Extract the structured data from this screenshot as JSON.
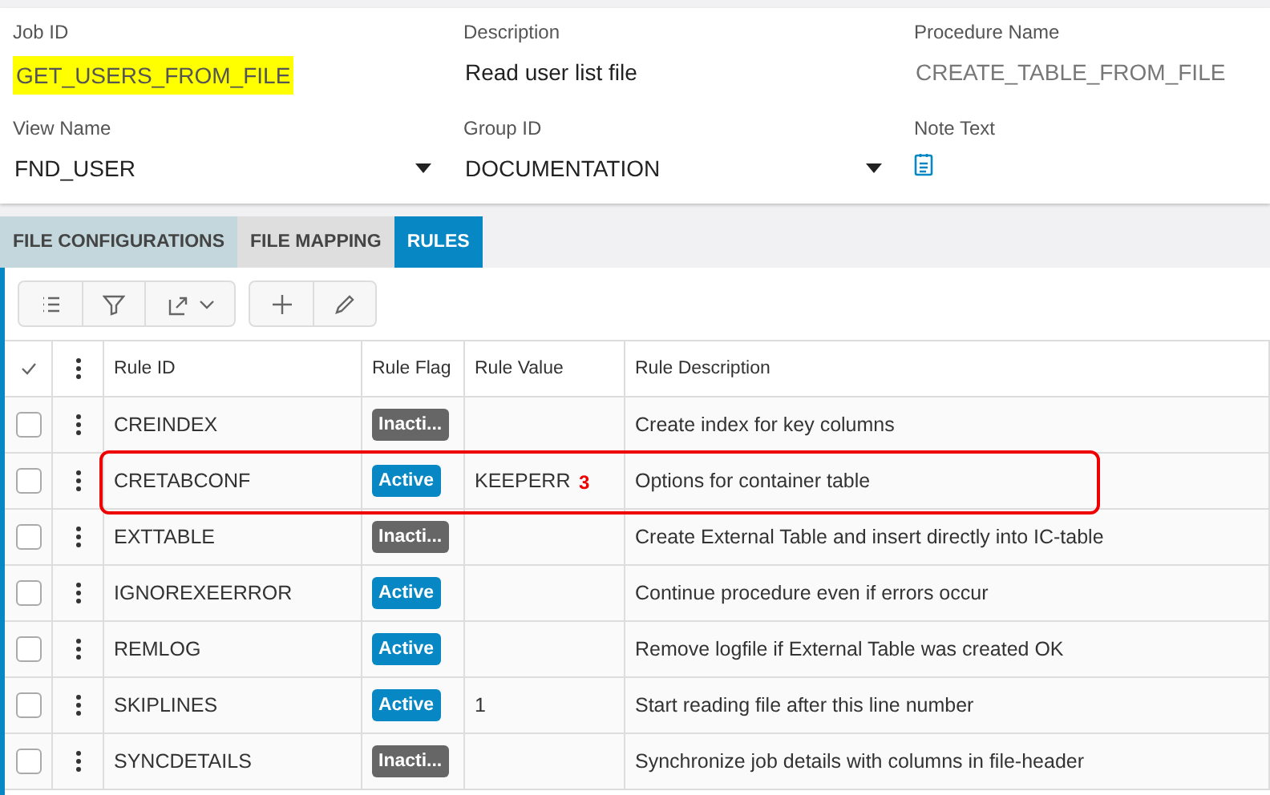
{
  "form": {
    "fields": [
      {
        "kind": "text",
        "label": "Job ID",
        "value": "GET_USERS_FROM_FILE",
        "highlighted": true,
        "disabled": false
      },
      {
        "kind": "text",
        "label": "Description",
        "value": "Read user list file",
        "highlighted": false,
        "disabled": false
      },
      {
        "kind": "text",
        "label": "Procedure Name",
        "value": "CREATE_TABLE_FROM_FILE",
        "highlighted": false,
        "disabled": true
      },
      {
        "kind": "select",
        "label": "View Name",
        "value": "FND_USER",
        "highlighted": false,
        "disabled": false
      },
      {
        "kind": "select",
        "label": "Group ID",
        "value": "DOCUMENTATION",
        "highlighted": false,
        "disabled": false
      },
      {
        "kind": "note",
        "label": "Note Text",
        "highlighted": false,
        "disabled": false
      }
    ]
  },
  "tabs": [
    {
      "label": "FILE CONFIGURATIONS",
      "selected": false,
      "hovered": true
    },
    {
      "label": "FILE MAPPING",
      "selected": false,
      "hovered": false
    },
    {
      "label": "RULES",
      "selected": true,
      "hovered": false
    }
  ],
  "table": {
    "columns": [
      "Rule ID",
      "Rule Flag",
      "Rule Value",
      "Rule Description"
    ],
    "rows": [
      {
        "checked": false,
        "rule_id": "CREINDEX",
        "flag": "Inacti...",
        "active": false,
        "value": "",
        "description": "Create index for key columns"
      },
      {
        "checked": false,
        "rule_id": "CRETABCONF",
        "flag": "Active",
        "active": true,
        "value": "KEEPERR",
        "description": "Options for container table",
        "callout": "3"
      },
      {
        "checked": false,
        "rule_id": "EXTTABLE",
        "flag": "Inacti...",
        "active": false,
        "value": "",
        "description": "Create External Table and insert directly into IC-table"
      },
      {
        "checked": false,
        "rule_id": "IGNOREXEERROR",
        "flag": "Active",
        "active": true,
        "value": "",
        "description": "Continue procedure even if errors occur"
      },
      {
        "checked": false,
        "rule_id": "REMLOG",
        "flag": "Active",
        "active": true,
        "value": "",
        "description": "Remove logfile if External Table was created OK"
      },
      {
        "checked": false,
        "rule_id": "SKIPLINES",
        "flag": "Active",
        "active": true,
        "value": "1",
        "description": "Start reading file after this line number"
      },
      {
        "checked": false,
        "rule_id": "SYNCDETAILS",
        "flag": "Inacti...",
        "active": false,
        "value": "",
        "description": "Synchronize job details with columns in file-header"
      }
    ]
  }
}
